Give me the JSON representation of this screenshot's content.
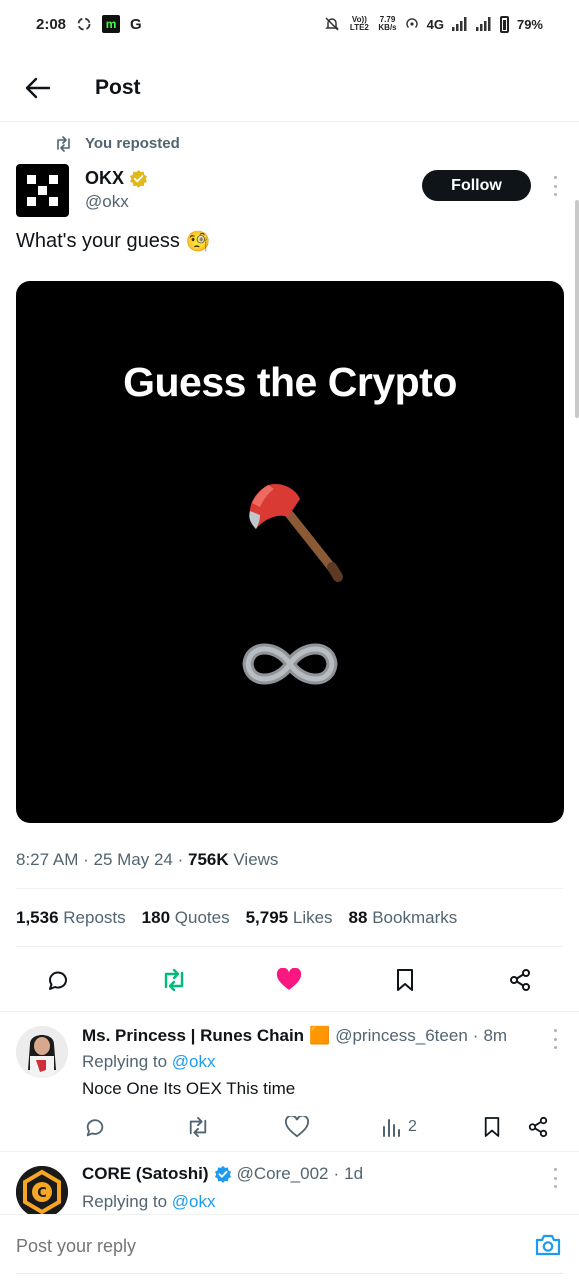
{
  "status_bar": {
    "time": "2:08",
    "app_badge": "m",
    "google_letter": "G",
    "lte_label": "Vo)) LTE2",
    "speed_value": "7.79",
    "speed_unit": "KB/s",
    "network": "4G",
    "battery": "79%"
  },
  "header": {
    "title": "Post"
  },
  "post": {
    "repost_label": "You reposted",
    "author_name": "OKX",
    "author_handle": "@okx",
    "follow_label": "Follow",
    "text": "What's your guess",
    "text_emoji": "🧐",
    "media_title": "Guess the Crypto",
    "time": "8:27 AM",
    "date": "25 May 24",
    "views_count": "756K",
    "views_label": "Views",
    "stats": [
      {
        "count": "1,536",
        "label": "Reposts"
      },
      {
        "count": "180",
        "label": "Quotes"
      },
      {
        "count": "5,795",
        "label": "Likes"
      },
      {
        "count": "88",
        "label": "Bookmarks"
      }
    ]
  },
  "colors": {
    "accent": "#1d9bf0",
    "like": "#f91880",
    "repost": "#00ba7c",
    "verified_gold": "#e2b719",
    "verified_blue": "#1d9bf0"
  },
  "replies": [
    {
      "name": "Ms. Princess | Runes Chain",
      "badge": "🟧",
      "handle": "@princess_6teen",
      "time": "8m",
      "replying_prefix": "Replying to",
      "replying_to": "@okx",
      "text": "Noce One Its OEX This time",
      "views": "2"
    },
    {
      "name": "CORE (Satoshi)",
      "handle": "@Core_002",
      "time": "1d",
      "replying_prefix": "Replying to",
      "replying_to": "@okx"
    }
  ],
  "reply_bar": {
    "placeholder": "Post your reply"
  }
}
